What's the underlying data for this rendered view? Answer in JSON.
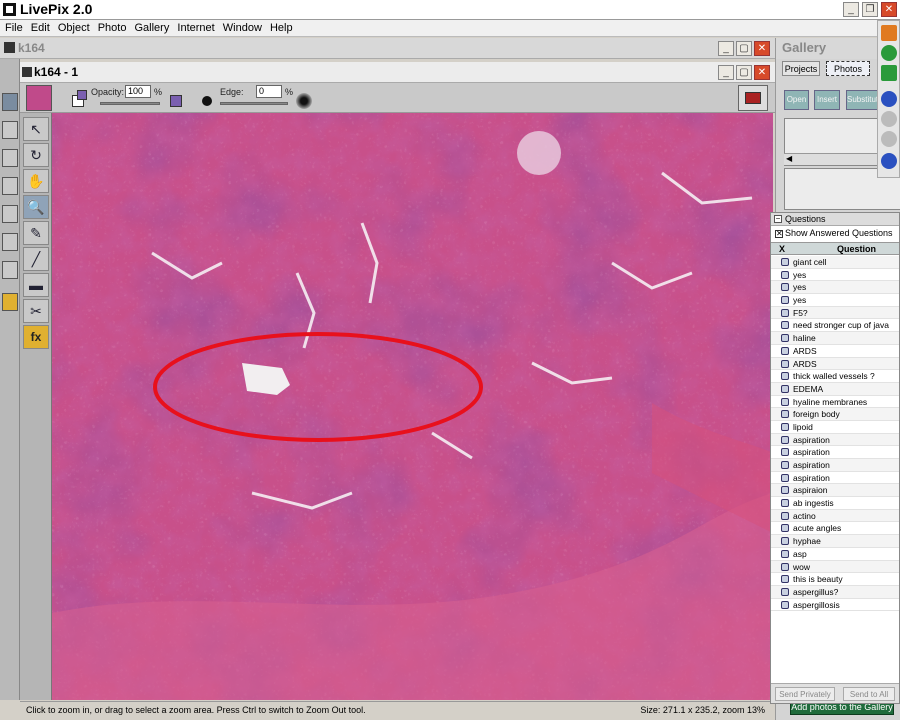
{
  "app": {
    "title": "LivePix 2.0"
  },
  "menu": [
    "File",
    "Edit",
    "Object",
    "Photo",
    "Gallery",
    "Internet",
    "Window",
    "Help"
  ],
  "outer_window": {
    "title": "k164"
  },
  "inner_window": {
    "title": "k164 - 1"
  },
  "options": {
    "opacity_label": "Opacity:",
    "opacity_value": "100",
    "edge_label": "Edge:",
    "edge_value": "0",
    "percent": "%"
  },
  "status": {
    "hint": "Click to zoom in, or drag to select a zoom area. Press Ctrl to switch to Zoom Out tool.",
    "size": "Size: 271.1 x 235.2, zoom 13%"
  },
  "gallery": {
    "title": "Gallery",
    "tabs": [
      "Projects",
      "Photos"
    ],
    "buttons": [
      "Open",
      "Insert",
      "Substitute"
    ],
    "add_button": "Add photos to the Gallery"
  },
  "questions": {
    "title": "Questions",
    "show_answered": "Show Answered Questions",
    "col_x": "X",
    "col_question": "Question",
    "items": [
      "giant cell",
      "yes",
      "yes",
      "yes",
      "F5?",
      "need stronger cup of java",
      "haline",
      "ARDS",
      "ARDS",
      "thick walled vessels ?",
      "EDEMA",
      "hyaline membranes",
      "foreign body",
      "lipoid",
      "aspiration",
      "aspiration",
      "aspiration",
      "aspiration",
      "aspiraion",
      "ab ingestis",
      "actino",
      "acute angles",
      "hyphae",
      "asp",
      "wow",
      "this is beauty",
      "aspergillus?",
      "aspergillosis"
    ],
    "send_privately": "Send Privately",
    "send_to_all": "Send to All"
  },
  "colors": {
    "tissue_base": "#c74a86",
    "annotation": "#e8101c",
    "gallery_add": "#1f6b3c"
  }
}
